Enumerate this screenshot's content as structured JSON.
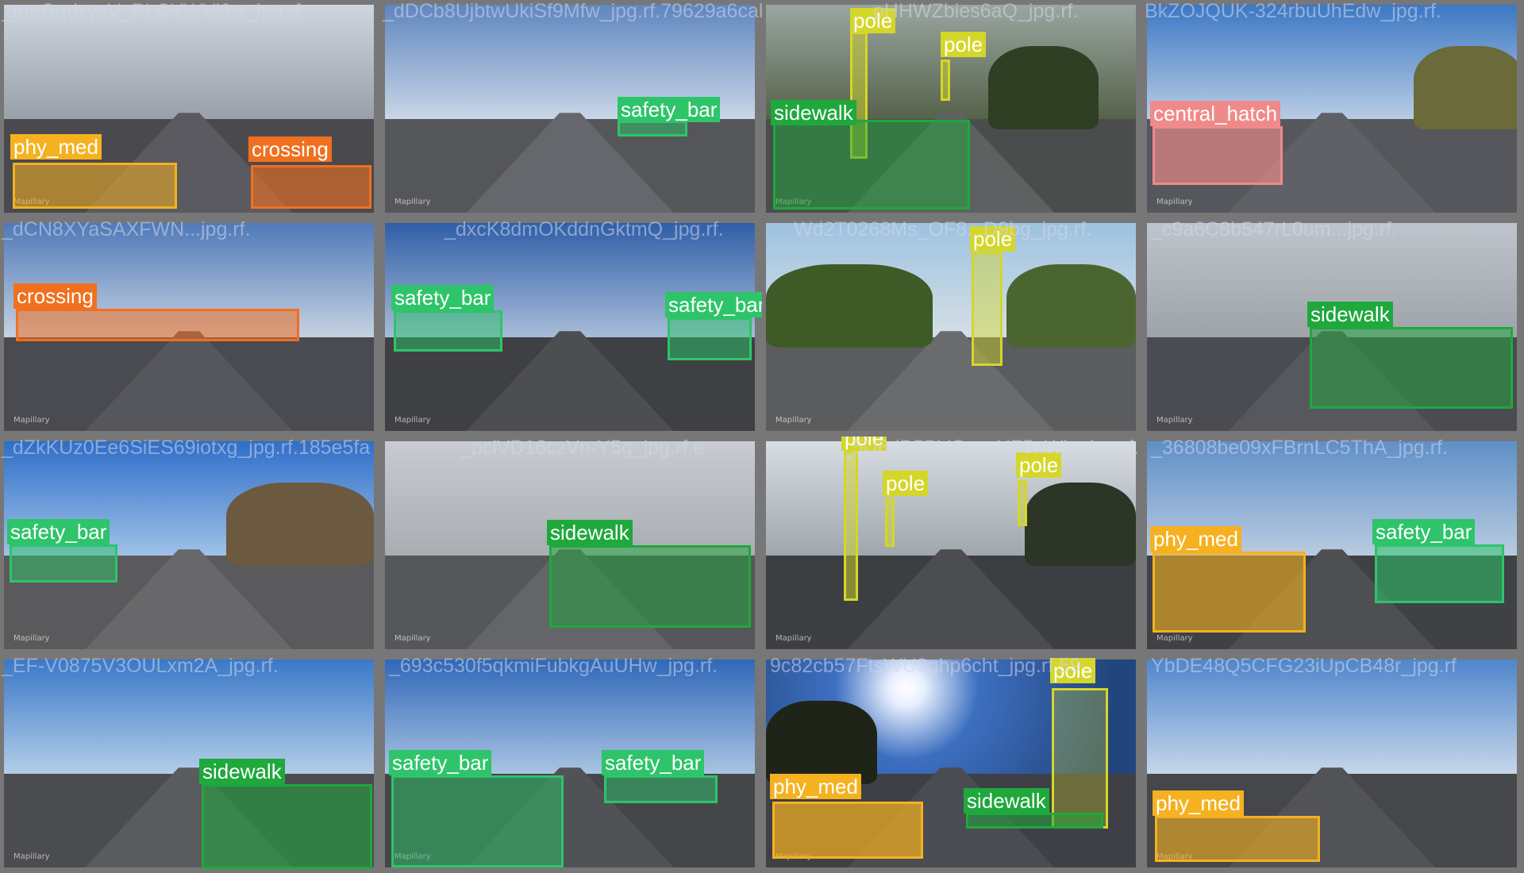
{
  "watermark": "Mapillary",
  "classes": {
    "phy_med": "#f5b120",
    "crossing": "#f07020",
    "safety_bar": "#2ec46a",
    "sidewalk": "#1fa83c",
    "pole": "#d4d62a",
    "central_hatch": "#f08a8a"
  },
  "tiles": [
    {
      "filename": "_muGgdxyzV_PLCYWVl6w_jpg.rf.",
      "labels": [
        "phy_med",
        "crossing"
      ]
    },
    {
      "filename": "_dDCb8UjbtwUkiSf9Mfw_jpg.rf.79629a6cab",
      "labels": [
        "safety_bar"
      ]
    },
    {
      "filename": "pHHWZbies6aQ_jpg.rf.",
      "labels": [
        "pole",
        "pole",
        "sidewalk"
      ]
    },
    {
      "filename": "BkZOJQUK-324rbuUhEdw_jpg.rf.",
      "labels": [
        "central_hatch"
      ]
    },
    {
      "filename": "_dCN8XYaSAXFWN...jpg.rf.",
      "labels": [
        "crossing"
      ]
    },
    {
      "filename": "_dxcK8dmOKddnGktmQ_jpg.rf.",
      "labels": [
        "safety_bar",
        "safety_bar"
      ]
    },
    {
      "filename": "Wd2T0268Ms_OF8...D9bg_jpg.rf.",
      "labels": [
        "pole"
      ]
    },
    {
      "filename": "_c9a6C8b547rL0um...jpg.rf.",
      "labels": [
        "sidewalk"
      ]
    },
    {
      "filename": "_dZkKUz0Ee6SiES69iotxg_jpg.rf.185e5fa",
      "labels": [
        "safety_bar"
      ]
    },
    {
      "filename": "_pclVD16czVn-Y5g_jpg.rf.e",
      "labels": [
        "sidewalk"
      ]
    },
    {
      "filename": "_5U6dB5BVOzxuYF5nWlq_jpg.rf.",
      "labels": [
        "pole",
        "pole",
        "pole"
      ]
    },
    {
      "filename": "_36808be09xFBrnLC5ThA_jpg.rf.",
      "labels": [
        "phy_med",
        "safety_bar"
      ]
    },
    {
      "filename": "_EF-V0875V3OULxm2A_jpg.rf.",
      "labels": [
        "sidewalk"
      ]
    },
    {
      "filename": "_693c530f5qkmiFubkgAuUHw_jpg.rf.",
      "labels": [
        "safety_bar",
        "safety_bar"
      ]
    },
    {
      "filename": "9c82cb57FtsWU9ghp6cht_jpg.rf.59",
      "labels": [
        "pole",
        "phy_med",
        "sidewalk"
      ]
    },
    {
      "filename": "YbDE48Q5CFG23iUpCB48r_jpg.rf",
      "labels": [
        "phy_med"
      ]
    }
  ]
}
